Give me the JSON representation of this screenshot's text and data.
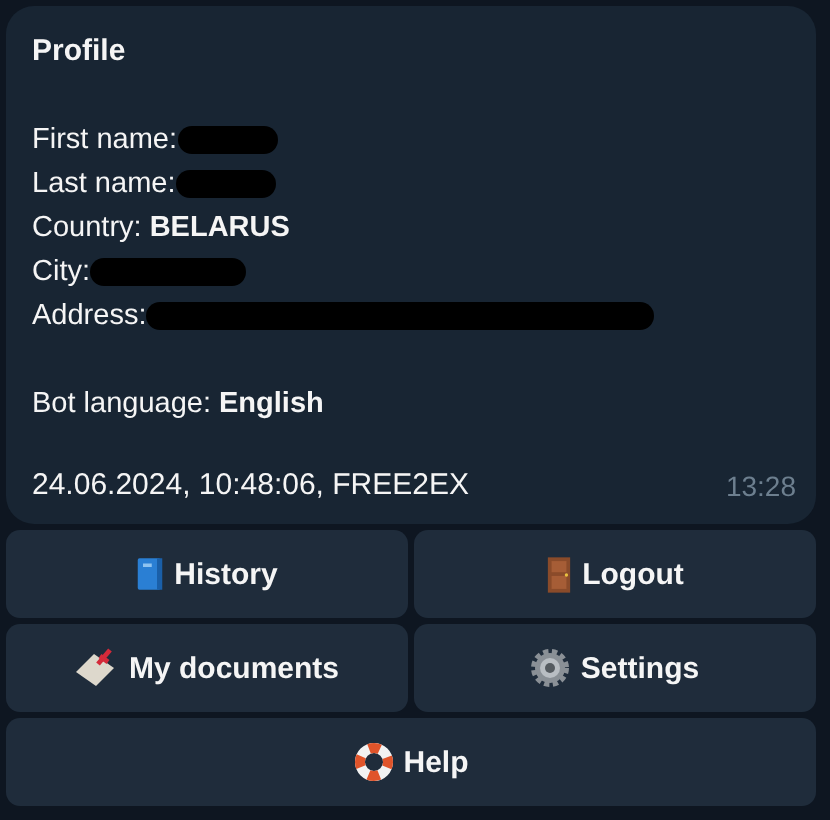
{
  "message": {
    "title": "Profile",
    "fields": [
      {
        "label": "First name:",
        "redacted": true
      },
      {
        "label": "Last name:",
        "redacted": true
      },
      {
        "label": "Country:",
        "value": "BELARUS",
        "redacted": false
      },
      {
        "label": "City:",
        "redacted": true
      },
      {
        "label": "Address:",
        "redacted": true
      }
    ],
    "language": {
      "label": "Bot language:",
      "value": "English"
    },
    "footer": "24.06.2024, 10:48:06, FREE2EX",
    "time": "13:28"
  },
  "buttons": [
    [
      {
        "label": "History"
      },
      {
        "label": "Logout"
      }
    ],
    [
      {
        "label": "My documents"
      },
      {
        "label": "Settings"
      }
    ],
    [
      {
        "label": "Help"
      }
    ]
  ]
}
